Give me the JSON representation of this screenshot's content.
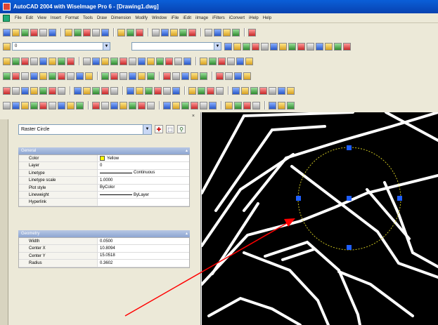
{
  "window": {
    "title": "AutoCAD 2004 with WiseImage Pro 6 - [Drawing1.dwg]"
  },
  "menubar": {
    "items": [
      "File",
      "Edit",
      "View",
      "Insert",
      "Format",
      "Tools",
      "Draw",
      "Dimension",
      "Modify",
      "Window",
      "iFile",
      "iEdit",
      "iImage",
      "iFilters",
      "iConvert",
      "iHelp",
      "Help"
    ]
  },
  "toolbar": {
    "layer_value": "0"
  },
  "properties": {
    "object_type": "Raster Circle",
    "sections": {
      "general": "General",
      "geometry": "Geometry"
    },
    "general_rows": [
      {
        "name": "Color",
        "value": "Yellow",
        "swatch": "#ffff00"
      },
      {
        "name": "Layer",
        "value": "0"
      },
      {
        "name": "Linetype",
        "value": "Continuous",
        "line": true
      },
      {
        "name": "Linetype scale",
        "value": "1.0000"
      },
      {
        "name": "Plot style",
        "value": "ByColor"
      },
      {
        "name": "Lineweight",
        "value": "ByLayer",
        "line": true
      },
      {
        "name": "Hyperlink",
        "value": ""
      }
    ],
    "geometry_rows": [
      {
        "name": "Width",
        "value": "0.0500"
      },
      {
        "name": "Center X",
        "value": "10.8094"
      },
      {
        "name": "Center Y",
        "value": "15.0518"
      },
      {
        "name": "Radius",
        "value": "0.3602"
      }
    ]
  },
  "icons": {
    "close": "close-icon",
    "quick_select": "quick-select-icon",
    "select_objects": "select-objects-icon",
    "pickadd": "pickadd-toggle-icon"
  },
  "colors": {
    "title_bar": "#0842b0",
    "grip": "#1f5fff",
    "selection_circle": "#c8c020",
    "annotation_arrow": "#ff0000"
  }
}
